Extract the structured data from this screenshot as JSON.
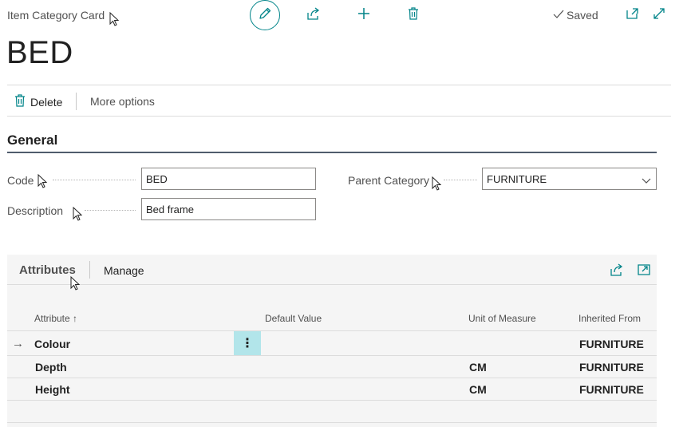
{
  "page": {
    "kind": "Item Category Card",
    "record_title": "BED"
  },
  "toolbar": {
    "edit_icon": "pencil-icon",
    "share_icon": "share-icon",
    "new_icon": "plus-icon",
    "delete_icon": "trash-icon",
    "status": "Saved",
    "open_new_window_icon": "open-in-new-window-icon",
    "expand_icon": "expand-icon",
    "accent_color": "#008489"
  },
  "actions": {
    "delete_label": "Delete",
    "more_label": "More options"
  },
  "general": {
    "title": "General",
    "code": {
      "label": "Code",
      "value": "BED"
    },
    "description": {
      "label": "Description",
      "value": "Bed frame"
    },
    "parent_category": {
      "label": "Parent Category",
      "value": "FURNITURE"
    }
  },
  "attributes": {
    "title": "Attributes",
    "manage_label": "Manage",
    "columns": {
      "attribute": "Attribute ↑",
      "default_value": "Default Value",
      "unit": "Unit of Measure",
      "inherited": "Inherited From"
    },
    "rows": [
      {
        "attribute": "Colour",
        "default_value": "",
        "unit": "",
        "inherited": "FURNITURE",
        "selected": true
      },
      {
        "attribute": "Depth",
        "default_value": "",
        "unit": "CM",
        "inherited": "FURNITURE"
      },
      {
        "attribute": "Height",
        "default_value": "",
        "unit": "CM",
        "inherited": "FURNITURE"
      }
    ],
    "row_menu_glyph": "⋮",
    "selected_row_marker": "→",
    "row_menu_color": "#b2e5ea"
  }
}
